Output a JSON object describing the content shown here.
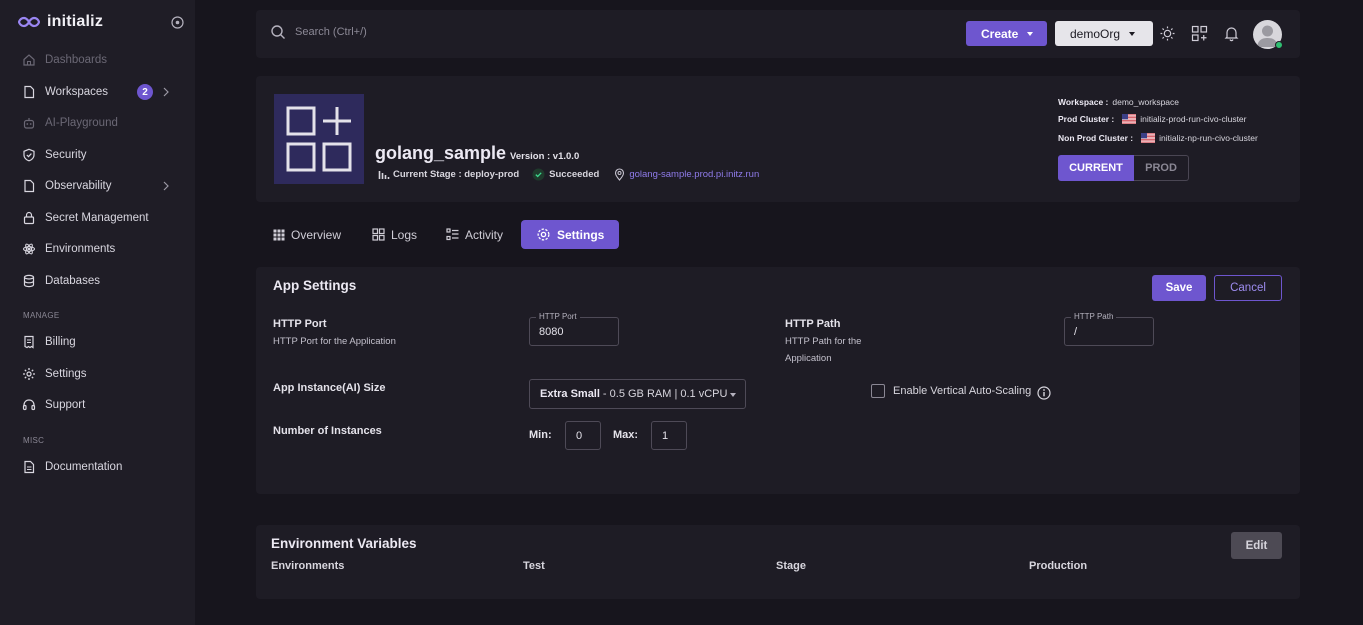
{
  "brand": {
    "name": "initializ",
    "accent": "#6e56cf"
  },
  "sidebar": {
    "items": [
      {
        "label": "Dashboards",
        "icon": "home-icon",
        "disabled": true
      },
      {
        "label": "Workspaces",
        "icon": "file-icon",
        "badge": "2"
      },
      {
        "label": "AI-Playground",
        "icon": "robot-icon",
        "disabled": true
      },
      {
        "label": "Security",
        "icon": "shield-icon"
      },
      {
        "label": "Observability",
        "icon": "file-icon"
      },
      {
        "label": "Secret Management",
        "icon": "lock-icon"
      },
      {
        "label": "Environments",
        "icon": "atom-icon"
      },
      {
        "label": "Databases",
        "icon": "database-icon"
      }
    ],
    "manage_label": "MANAGE",
    "manage_items": [
      {
        "label": "Billing",
        "icon": "receipt-icon"
      },
      {
        "label": "Settings",
        "icon": "gear-icon"
      },
      {
        "label": "Support",
        "icon": "headset-icon"
      }
    ],
    "misc_label": "MISC",
    "misc_items": [
      {
        "label": "Documentation",
        "icon": "document-icon"
      }
    ]
  },
  "topbar": {
    "search_placeholder": "Search (Ctrl+/)",
    "create_label": "Create",
    "org_label": "demoOrg"
  },
  "app": {
    "name": "golang_sample",
    "version_label": "Version : v1.0.0",
    "stage_label": "Current Stage : deploy-prod",
    "status": "Succeeded",
    "url": "golang-sample.prod.pi.initz.run",
    "workspace_label": "Workspace :",
    "workspace_value": "demo_workspace",
    "prod_cluster_label": "Prod Cluster :",
    "prod_cluster_value": "initializ-prod-run-civo-cluster",
    "nonprod_cluster_label": "Non Prod Cluster :",
    "nonprod_cluster_value": "initializ-np-run-civo-cluster",
    "env_current": "CURRENT",
    "env_prod": "PROD"
  },
  "tabs": [
    {
      "label": "Overview",
      "icon": "grid-icon"
    },
    {
      "label": "Logs",
      "icon": "blocks-icon"
    },
    {
      "label": "Activity",
      "icon": "list-icon"
    },
    {
      "label": "Settings",
      "icon": "gear-icon",
      "active": true
    }
  ],
  "settings": {
    "title": "App Settings",
    "save_label": "Save",
    "cancel_label": "Cancel",
    "http_port_title": "HTTP Port",
    "http_port_desc": "HTTP Port for the Application",
    "http_port_legend": "HTTP Port",
    "http_port_value": "8080",
    "http_path_title": "HTTP Path",
    "http_path_desc_1": "HTTP Path for the",
    "http_path_desc_2": "Application",
    "http_path_legend": "HTTP Path",
    "http_path_value": "/",
    "instance_size_title": "App Instance(AI) Size",
    "instance_size_name": "Extra Small",
    "instance_size_detail": "- 0.5 GB RAM | 0.1 vCPU",
    "autoscale_label": "Enable Vertical Auto-Scaling",
    "autoscale_checked": false,
    "instances_title": "Number of Instances",
    "min_label": "Min:",
    "min_value": "0",
    "max_label": "Max:",
    "max_value": "1"
  },
  "env_vars": {
    "title": "Environment Variables",
    "edit_label": "Edit",
    "columns": [
      "Environments",
      "Test",
      "Stage",
      "Production"
    ]
  }
}
